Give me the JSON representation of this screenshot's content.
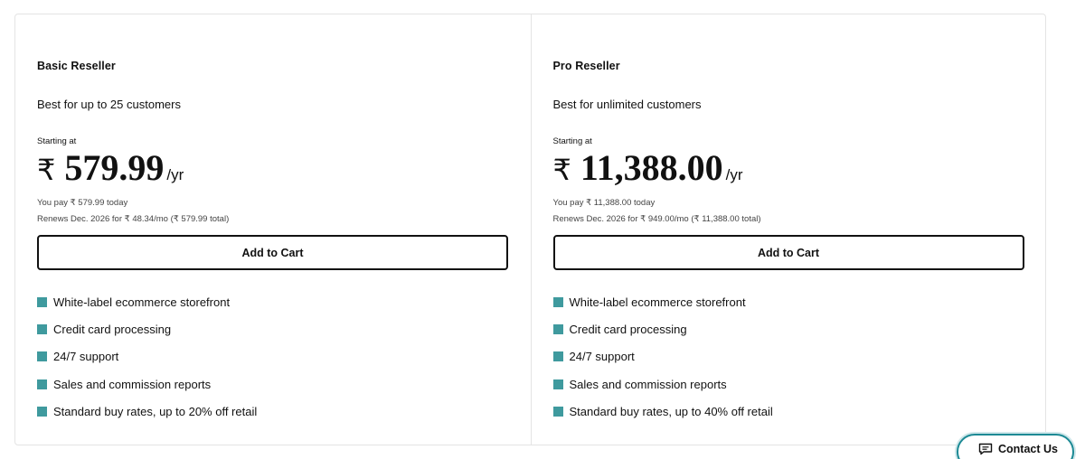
{
  "plans": [
    {
      "name": "Basic Reseller",
      "description": "Best for up to 25 customers",
      "starting_label": "Starting at",
      "currency": "₹",
      "price": "579.99",
      "period": "/yr",
      "pay_today": "You pay ₹ 579.99 today",
      "renews": "Renews Dec. 2026 for ₹ 48.34/mo (₹ 579.99 total)",
      "cta": "Add to Cart",
      "features": [
        "White-label ecommerce storefront",
        "Credit card processing",
        "24/7 support",
        "Sales and commission reports",
        "Standard buy rates, up to 20% off retail"
      ]
    },
    {
      "name": "Pro Reseller",
      "description": "Best for unlimited customers",
      "starting_label": "Starting at",
      "currency": "₹",
      "price": "11,388.00",
      "period": "/yr",
      "pay_today": "You pay ₹ 11,388.00 today",
      "renews": "Renews Dec. 2026 for ₹ 949.00/mo (₹ 11,388.00 total)",
      "cta": "Add to Cart",
      "features": [
        "White-label ecommerce storefront",
        "Credit card processing",
        "24/7 support",
        "Sales and commission reports",
        "Standard buy rates, up to 40% off retail"
      ]
    }
  ],
  "contact": {
    "label": "Contact Us",
    "icon": "chat-icon"
  },
  "colors": {
    "feature_check": "#3f9a9e",
    "contact_border": "#1d8a95",
    "text": "#111111",
    "border": "#e4e4e4"
  }
}
